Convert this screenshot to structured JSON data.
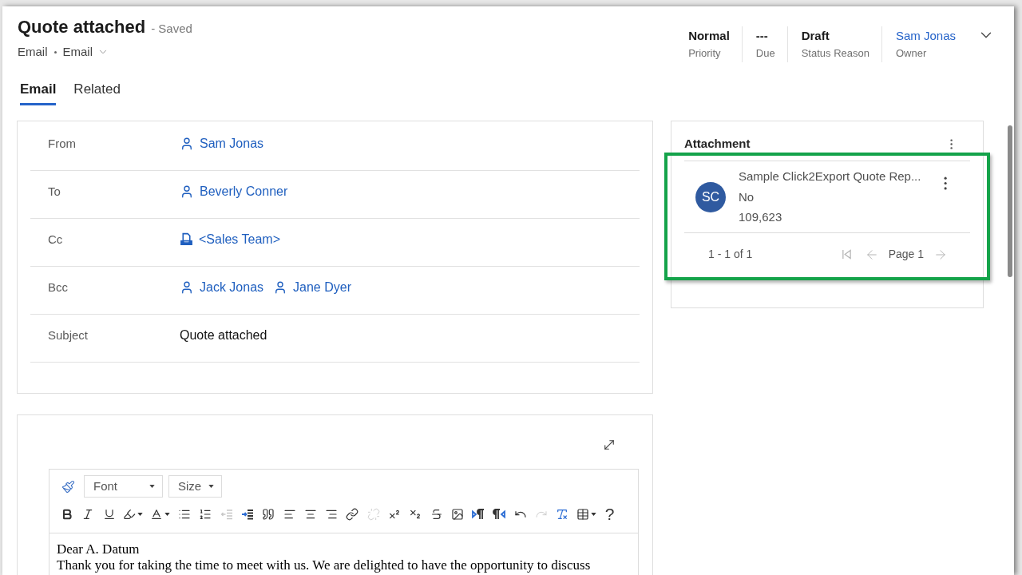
{
  "header": {
    "title": "Quote attached",
    "save_status": "- Saved",
    "entity": "Email",
    "form": "Email",
    "fields": [
      {
        "value": "Normal",
        "label": "Priority",
        "kind": "text"
      },
      {
        "value": "---",
        "label": "Due",
        "kind": "text"
      },
      {
        "value": "Draft",
        "label": "Status Reason",
        "kind": "text"
      },
      {
        "value": "Sam Jonas",
        "label": "Owner",
        "kind": "link"
      }
    ]
  },
  "tabs": [
    {
      "label": "Email",
      "selected": true
    },
    {
      "label": "Related",
      "selected": false
    }
  ],
  "email_fields": [
    {
      "label": "From",
      "kind": "lookup",
      "values": [
        {
          "name": "Sam Jonas",
          "kind": "user"
        }
      ]
    },
    {
      "label": "To",
      "kind": "lookup",
      "values": [
        {
          "name": "Beverly Conner",
          "kind": "user"
        }
      ]
    },
    {
      "label": "Cc",
      "kind": "lookup",
      "values": [
        {
          "name": "<Sales Team>",
          "kind": "queue"
        }
      ]
    },
    {
      "label": "Bcc",
      "kind": "lookup",
      "values": [
        {
          "name": "Jack Jonas",
          "kind": "user"
        },
        {
          "name": "Jane Dyer",
          "kind": "user"
        }
      ]
    },
    {
      "label": "Subject",
      "kind": "text",
      "value": "Quote attached"
    }
  ],
  "attachment": {
    "title": "Attachment",
    "highlighted": true,
    "items": [
      {
        "initials": "SC",
        "title": "Sample Click2Export Quote Rep...",
        "field_2": "No",
        "field_3": "109,623"
      }
    ],
    "record_count": "1 - 1 of 1",
    "pager": {
      "first_page": {
        "disabled": true
      },
      "previous": {
        "disabled": true
      },
      "page": "Page 1",
      "next": {
        "disabled": true
      }
    }
  },
  "editor": {
    "font": "Font",
    "size": "Size",
    "toolbar": [
      {
        "kind": "bold",
        "disabled": false
      },
      {
        "kind": "italic",
        "disabled": false
      },
      {
        "kind": "underline",
        "disabled": false
      },
      {
        "kind": "highlight",
        "disabled": false
      },
      {
        "kind": "font_color",
        "disabled": false
      },
      {
        "kind": "bullets",
        "disabled": false
      },
      {
        "kind": "numbering",
        "disabled": false
      },
      {
        "kind": "outdent",
        "disabled": true
      },
      {
        "kind": "indent",
        "disabled": false
      },
      {
        "kind": "quote",
        "disabled": false
      },
      {
        "kind": "align_left",
        "disabled": false
      },
      {
        "kind": "align_center",
        "disabled": false
      },
      {
        "kind": "align_right",
        "disabled": false
      },
      {
        "kind": "link",
        "disabled": false
      },
      {
        "kind": "unlink",
        "disabled": true
      },
      {
        "kind": "superscript",
        "disabled": false
      },
      {
        "kind": "subscript",
        "disabled": false
      },
      {
        "kind": "strikethrough",
        "disabled": false
      },
      {
        "kind": "image",
        "disabled": false
      },
      {
        "kind": "ltr",
        "disabled": false
      },
      {
        "kind": "rtl",
        "disabled": false
      },
      {
        "kind": "undo",
        "disabled": false
      },
      {
        "kind": "redo",
        "disabled": true
      },
      {
        "kind": "clear_format",
        "disabled": false
      },
      {
        "kind": "table",
        "disabled": false
      },
      {
        "kind": "help",
        "disabled": false,
        "label": "?"
      }
    ],
    "body": [
      "Dear A. Datum",
      "Thank you for taking the time to meet with us. We are delighted to have the opportunity to discuss"
    ]
  }
}
